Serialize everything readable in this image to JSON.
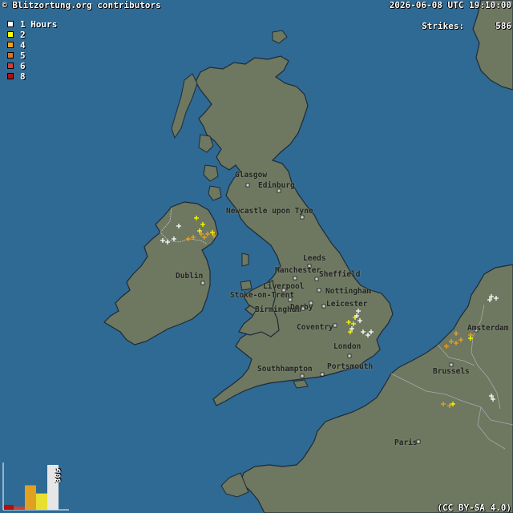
{
  "header": {
    "credit": "© Blitzortung.org contributors",
    "timestamp": "2026-06-08 UTC 19:10:00",
    "strikes_label": "Strikes:",
    "strikes_value": "586"
  },
  "legend": {
    "items": [
      {
        "label": "1 Hours",
        "color": "#ffffff"
      },
      {
        "label": "2",
        "color": "#ffff00"
      },
      {
        "label": "4",
        "color": "#f0a020"
      },
      {
        "label": "5",
        "color": "#e07020"
      },
      {
        "label": "6",
        "color": "#d04030"
      },
      {
        "label": "8",
        "color": "#b01010"
      }
    ]
  },
  "cities": [
    {
      "name": "Glasgow"
    },
    {
      "name": "Edinburg"
    },
    {
      "name": "Newcastle upon Tyne"
    },
    {
      "name": "Dublin"
    },
    {
      "name": "Leeds"
    },
    {
      "name": "Manchester"
    },
    {
      "name": "Sheffield"
    },
    {
      "name": "Liverpool"
    },
    {
      "name": "Stoke-on-Trent"
    },
    {
      "name": "Nottingham"
    },
    {
      "name": "Birmingham"
    },
    {
      "name": "Derby"
    },
    {
      "name": "Leicester"
    },
    {
      "name": "Coventry"
    },
    {
      "name": "London"
    },
    {
      "name": "Southhampton"
    },
    {
      "name": "Portsmouth"
    },
    {
      "name": "Amsterdam"
    },
    {
      "name": "Brussels"
    },
    {
      "name": "Paris"
    }
  ],
  "histogram": {
    "label": "305",
    "bars": [
      {
        "value": 6,
        "color": "#b01010"
      },
      {
        "value": 4,
        "color": "#d04030"
      },
      {
        "value": 30,
        "color": "#e0a020"
      },
      {
        "value": 20,
        "color": "#e8e030"
      },
      {
        "value": 55,
        "color": "#e6e6e6"
      }
    ]
  },
  "license": "(CC BY-SA 4.0)",
  "colors": {
    "sea": "#2e6a94",
    "land": "#6e7760",
    "coast": "#1e2a36",
    "border": "#9aa0a8"
  }
}
